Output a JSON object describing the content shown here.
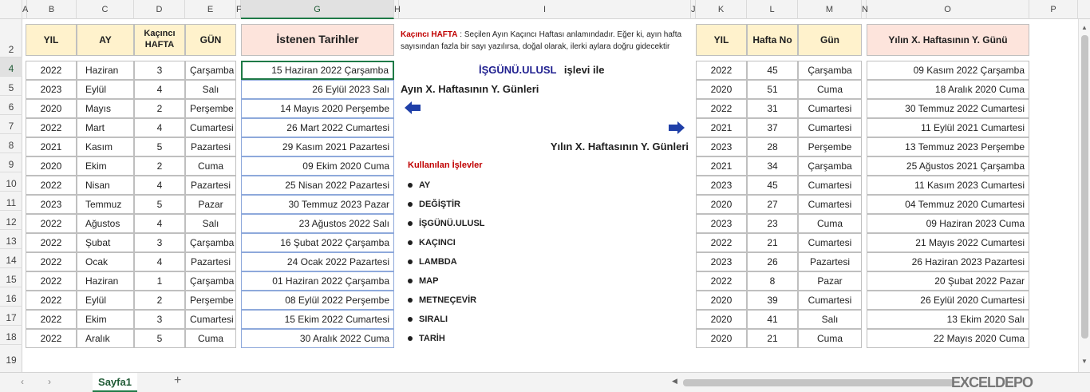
{
  "columns": [
    "A",
    "B",
    "C",
    "D",
    "E",
    "F",
    "G",
    "H",
    "I",
    "J",
    "K",
    "L",
    "M",
    "N",
    "O",
    "P"
  ],
  "rows": [
    "2",
    "4",
    "5",
    "6",
    "7",
    "8",
    "9",
    "10",
    "11",
    "12",
    "13",
    "14",
    "15",
    "16",
    "17",
    "18",
    "19"
  ],
  "left_table": {
    "headers": {
      "yil": "YIL",
      "ay": "AY",
      "kacinci": "Kaçıncı HAFTA",
      "gun": "GÜN"
    },
    "result_header": "İstenen Tarihler",
    "rows": [
      [
        "2022",
        "Haziran",
        "3",
        "Çarşamba",
        "15 Haziran 2022 Çarşamba"
      ],
      [
        "2023",
        "Eylül",
        "4",
        "Salı",
        "26 Eylül 2023 Salı"
      ],
      [
        "2020",
        "Mayıs",
        "2",
        "Perşembe",
        "14 Mayıs 2020 Perşembe"
      ],
      [
        "2022",
        "Mart",
        "4",
        "Cumartesi",
        "26 Mart 2022 Cumartesi"
      ],
      [
        "2021",
        "Kasım",
        "5",
        "Pazartesi",
        "29 Kasım 2021 Pazartesi"
      ],
      [
        "2020",
        "Ekim",
        "2",
        "Cuma",
        "09 Ekim 2020 Cuma"
      ],
      [
        "2022",
        "Nisan",
        "4",
        "Pazartesi",
        "25 Nisan 2022 Pazartesi"
      ],
      [
        "2023",
        "Temmuz",
        "5",
        "Pazar",
        "30 Temmuz 2023 Pazar"
      ],
      [
        "2022",
        "Ağustos",
        "4",
        "Salı",
        "23 Ağustos 2022 Salı"
      ],
      [
        "2022",
        "Şubat",
        "3",
        "Çarşamba",
        "16 Şubat 2022 Çarşamba"
      ],
      [
        "2022",
        "Ocak",
        "4",
        "Pazartesi",
        "24 Ocak 2022 Pazartesi"
      ],
      [
        "2022",
        "Haziran",
        "1",
        "Çarşamba",
        "01 Haziran 2022 Çarşamba"
      ],
      [
        "2022",
        "Eylül",
        "2",
        "Perşembe",
        "08 Eylül 2022 Perşembe"
      ],
      [
        "2022",
        "Ekim",
        "3",
        "Cumartesi",
        "15 Ekim 2022 Cumartesi"
      ],
      [
        "2022",
        "Aralık",
        "5",
        "Cuma",
        "30 Aralık 2022 Cuma"
      ]
    ]
  },
  "right_table": {
    "headers": {
      "yil": "YIL",
      "hafta": "Hafta No",
      "gun": "Gün"
    },
    "result_header": "Yılın X. Haftasının Y. Günü",
    "rows": [
      [
        "2022",
        "45",
        "Çarşamba",
        "09 Kasım 2022 Çarşamba"
      ],
      [
        "2020",
        "51",
        "Cuma",
        "18 Aralık 2020 Cuma"
      ],
      [
        "2022",
        "31",
        "Cumartesi",
        "30 Temmuz 2022 Cumartesi"
      ],
      [
        "2021",
        "37",
        "Cumartesi",
        "11 Eylül 2021 Cumartesi"
      ],
      [
        "2023",
        "28",
        "Perşembe",
        "13 Temmuz 2023 Perşembe"
      ],
      [
        "2021",
        "34",
        "Çarşamba",
        "25 Ağustos 2021 Çarşamba"
      ],
      [
        "2023",
        "45",
        "Cumartesi",
        "11 Kasım 2023 Cumartesi"
      ],
      [
        "2020",
        "27",
        "Cumartesi",
        "04 Temmuz 2020 Cumartesi"
      ],
      [
        "2023",
        "23",
        "Cuma",
        "09 Haziran 2023 Cuma"
      ],
      [
        "2022",
        "21",
        "Cumartesi",
        "21 Mayıs 2022 Cumartesi"
      ],
      [
        "2023",
        "26",
        "Pazartesi",
        "26 Haziran 2023 Pazartesi"
      ],
      [
        "2022",
        "8",
        "Pazar",
        "20 Şubat 2022 Pazar"
      ],
      [
        "2020",
        "39",
        "Cumartesi",
        "26 Eylül 2020 Cumartesi"
      ],
      [
        "2020",
        "41",
        "Salı",
        "13 Ekim 2020 Salı"
      ],
      [
        "2020",
        "21",
        "Cuma",
        "22 Mayıs 2020 Cuma"
      ]
    ]
  },
  "notes": {
    "note_label": "Kaçıncı HAFTA",
    "note_text_1": ": Seçilen Ayın Kaçıncı Haftası anlamındadır. Eğer ki, ayın hafta",
    "note_text_2": "sayısından fazla bir sayı yazılırsa, doğal olarak, ilerki aylara doğru gidecektir",
    "func_name": "İŞGÜNÜ.ULUSL",
    "func_suffix": "işlevi  ile",
    "month_title": "Ayın X. Haftasının Y. Günleri",
    "year_title": "Yılın X. Haftasının Y. Günleri",
    "used_title": "Kullanılan İşlevler",
    "functions": [
      "AY",
      "DEĞİŞTİR",
      "İŞGÜNÜ.ULUSL",
      "KAÇINCI",
      "LAMBDA",
      "MAP",
      "METNEÇEVİR",
      "SIRALI",
      "TARİH"
    ]
  },
  "sheet_tab": "Sayfa1",
  "add_sheet": "+",
  "watermark": "EXCELDEPO",
  "colors": {
    "yellow_header": "#fff2cc",
    "pink_header": "#fde4dc",
    "note_red": "#c00000",
    "func_blue": "#1f1f8f",
    "arrow_blue": "#1f3fa8"
  }
}
